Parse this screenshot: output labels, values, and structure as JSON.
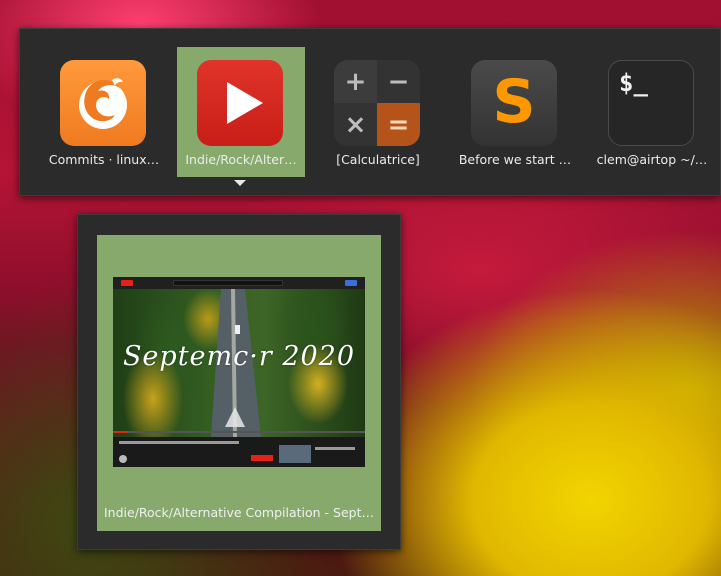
{
  "switcher": {
    "apps": [
      {
        "label": "Commits · linux…",
        "icon": "firefox-icon"
      },
      {
        "label": "Indie/Rock/Alter…",
        "icon": "youtube-icon",
        "selected": true
      },
      {
        "label": "[Calculatrice]",
        "icon": "calculator-icon",
        "keys": [
          "+",
          "−",
          "×",
          "="
        ]
      },
      {
        "label": "Before we start …",
        "icon": "sublime-text-icon",
        "glyph": "S"
      },
      {
        "label": "clem@airtop ~/…",
        "icon": "terminal-icon",
        "glyph": "$_"
      }
    ],
    "selected_color": "#87a96b"
  },
  "preview": {
    "window_title": "Indie/Rock/Alternative Compilation - Sept…",
    "thumbnail": {
      "video_overlay_text": "Septemc·r 2020"
    }
  },
  "colors": {
    "panel_bg": "#2b2b2b",
    "selection": "#87a96b",
    "youtube_red": "#d7281f",
    "firefox_orange": "#f58a2a",
    "calc_orange": "#c15a1c"
  }
}
